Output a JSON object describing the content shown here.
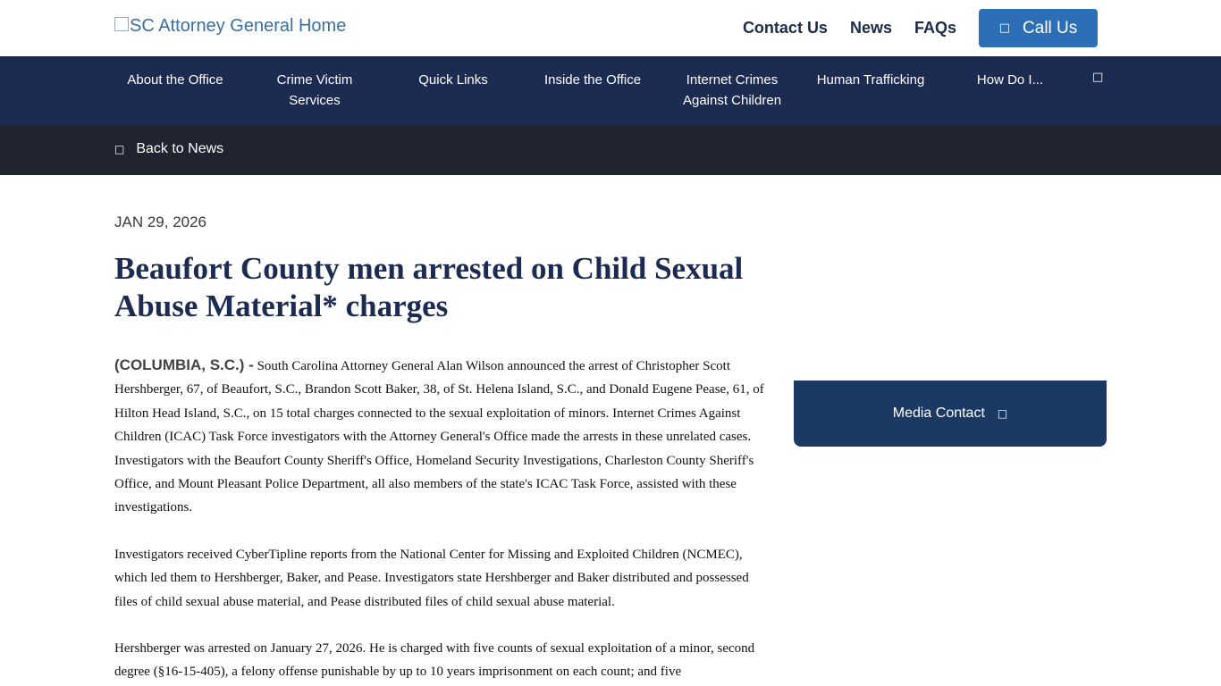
{
  "header": {
    "logo_alt": "SC Attorney General Home",
    "links": [
      "Contact Us",
      "News",
      "FAQs"
    ],
    "call_label": "Call Us",
    "call_icon": "phone-icon"
  },
  "nav": {
    "items": [
      [
        "About the Office"
      ],
      [
        "Crime Victim",
        "Services"
      ],
      [
        "Quick Links"
      ],
      [
        "Inside the Office"
      ],
      [
        "Internet Crimes",
        "Against Children"
      ],
      [
        "Human Trafficking"
      ],
      [
        "How Do I..."
      ]
    ],
    "search_icon": "search-icon"
  },
  "back": {
    "label": "Back to News",
    "icon": "chevron-left-icon"
  },
  "article": {
    "date": "JAN 29, 2026",
    "title": "Beaufort County men arrested on Child Sexual Abuse Material* charges",
    "dateline": "(COLUMBIA, S.C.) -",
    "paragraph1": "South Carolina Attorney General Alan Wilson announced the arrest of Christopher Scott Hershberger, 67, of Beaufort, S.C., Brandon Scott Baker, 38, of St. Helena Island, S.C., and Donald Eugene Pease, 61, of Hilton Head Island, S.C., on 15 total charges connected to the sexual exploitation of minors. Internet Crimes Against Children (ICAC) Task Force investigators with the Attorney General's Office made the arrests in these unrelated cases. Investigators with the Beaufort County Sheriff's Office, Homeland Security Investigations, Charleston County Sheriff's Office, and Mount Pleasant Police Department, all also members of the state's ICAC Task Force, assisted with these investigations.",
    "paragraph2": "Investigators received CyberTipline reports from the National Center for Missing and Exploited Children (NCMEC), which led them to Hershberger, Baker, and Pease. Investigators state Hershberger and Baker distributed and possessed files of child sexual abuse material, and Pease distributed files of child sexual abuse material.",
    "paragraph3": "Hershberger was arrested on January 27, 2026. He is charged with five counts of sexual exploitation of a minor, second degree (§16-15-405), a felony offense punishable by up to 10 years imprisonment on each count; and five"
  },
  "sidebar": {
    "media_label": "Media Contact",
    "media_icon": "chevron-down-icon"
  },
  "colors": {
    "nav_bg": "#1b2b52",
    "back_bg": "#1f2430",
    "call_bg": "#2d6fb6",
    "media_bg": "#1b3a63",
    "title": "#1b2b52"
  }
}
